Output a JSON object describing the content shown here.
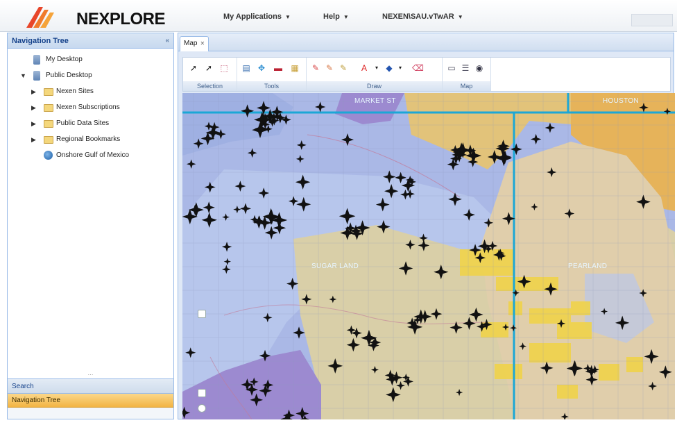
{
  "header": {
    "logo_text": "NEXPLORE",
    "menus": [
      {
        "label": "My Applications"
      },
      {
        "label": "Help"
      },
      {
        "label": "NEXEN\\SAU.vTwAR"
      }
    ]
  },
  "nav_tree": {
    "title": "Navigation Tree",
    "items": [
      {
        "label": "My Desktop",
        "icon": "desktop-icon",
        "level": 1,
        "expander": ""
      },
      {
        "label": "Public Desktop",
        "icon": "desktop-icon",
        "level": 0,
        "expander": "▼"
      },
      {
        "label": "Nexen Sites",
        "icon": "folder-icon",
        "level": 1,
        "expander": "▶"
      },
      {
        "label": "Nexen Subscriptions",
        "icon": "folder-icon",
        "level": 1,
        "expander": "▶"
      },
      {
        "label": "Public Data Sites",
        "icon": "folder-icon",
        "level": 1,
        "expander": "▶"
      },
      {
        "label": "Regional Bookmarks",
        "icon": "folder-icon",
        "level": 1,
        "expander": "▶"
      },
      {
        "label": "Onshore Gulf of Mexico",
        "icon": "globe-icon",
        "level": 1,
        "expander": ""
      }
    ]
  },
  "accordion": {
    "search_label": "Search",
    "nav_label": "Navigation Tree"
  },
  "tabs": [
    {
      "label": "Map"
    }
  ],
  "toolbar": {
    "groups": [
      {
        "label": "Selection"
      },
      {
        "label": "Tools"
      },
      {
        "label": "Draw"
      },
      {
        "label": "Map"
      }
    ]
  },
  "map": {
    "labels": [
      {
        "text": "MARKET ST"
      },
      {
        "text": "HOUSTON"
      },
      {
        "text": "SUGAR LAND"
      },
      {
        "text": "PEARLAND"
      }
    ]
  },
  "colors": {
    "accent": "#99bbe8",
    "selected": "#f2b443",
    "map_blue": "#aab8e6",
    "map_tan": "#d9cfa8",
    "map_yellow": "#f0d34a",
    "map_purple": "#9c8ad0",
    "boundary": "#1ba7d6"
  }
}
